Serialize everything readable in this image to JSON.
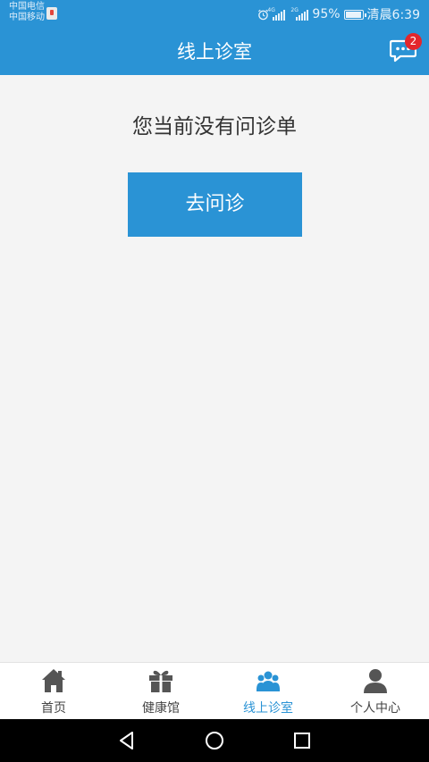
{
  "status_bar": {
    "carrier_1": "中国电信",
    "carrier_2": "中国移动",
    "network_1": "4G",
    "network_2": "2G",
    "battery": "95%",
    "time": "清晨6:39"
  },
  "header": {
    "title": "线上诊室",
    "message_badge": "2"
  },
  "main": {
    "empty_text": "您当前没有问诊单",
    "consult_button": "去问诊"
  },
  "tabs": [
    {
      "label": "首页",
      "icon": "home-icon"
    },
    {
      "label": "健康馆",
      "icon": "gift-icon"
    },
    {
      "label": "线上诊室",
      "icon": "consult-room-icon",
      "active": true
    },
    {
      "label": "个人中心",
      "icon": "person-icon"
    }
  ],
  "colors": {
    "primary": "#2a93d5",
    "background": "#f4f4f4",
    "badge": "#e3262c",
    "tab_icon": "#555555"
  }
}
